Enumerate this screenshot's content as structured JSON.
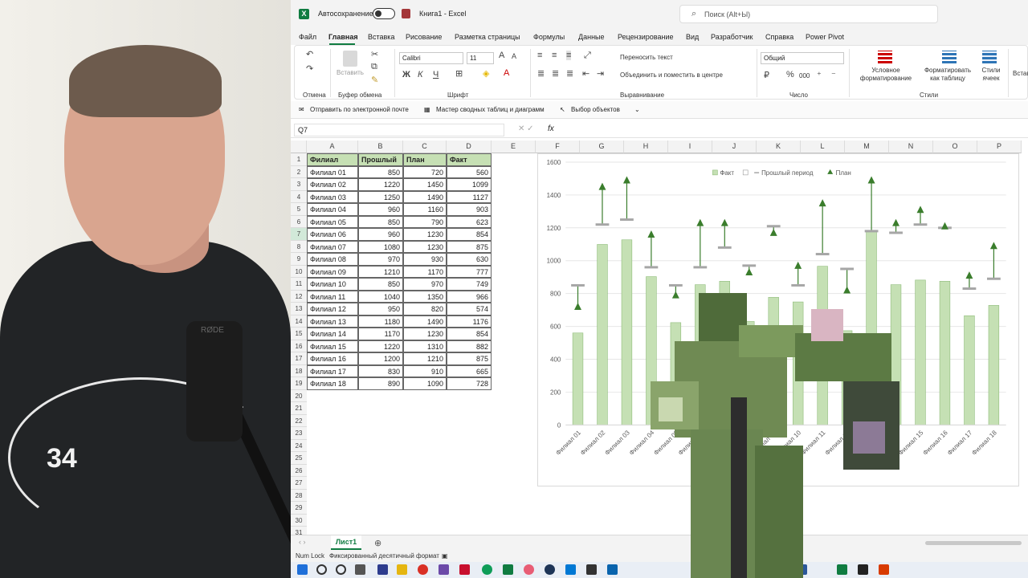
{
  "window": {
    "autosave_label": "Автосохранение",
    "title": "Книга1  -  Excel",
    "search_placeholder": "Поиск (Alt+Ы)"
  },
  "menu": [
    "Файл",
    "Главная",
    "Вставка",
    "Рисование",
    "Разметка страницы",
    "Формулы",
    "Данные",
    "Рецензирование",
    "Вид",
    "Разработчик",
    "Справка",
    "Power Pivot"
  ],
  "ribbon": {
    "undo_group": "Отмена",
    "paste_label": "Вставить",
    "clipboard_group": "Буфер обмена",
    "font_name": "Calibri",
    "font_size": "11",
    "font_group": "Шрифт",
    "bold": "Ж",
    "italic": "К",
    "underline": "Ч",
    "wrap_text": "Переносить текст",
    "merge_center": "Объединить и поместить в центре",
    "alignment_group": "Выравнивание",
    "number_format": "Общий",
    "number_group": "Число",
    "percent": "%",
    "thousands": "000",
    "conditional_formatting": "Условное форматирование",
    "format_as_table": "Форматировать как таблицу",
    "cell_styles": "Стили ячеек",
    "styles_group": "Стили",
    "insert_partial": "Встав"
  },
  "quick_access": {
    "send_email": "Отправить по электронной почте",
    "pivot_wizard": "Мастер сводных таблиц и диаграмм",
    "select_objects": "Выбор объектов"
  },
  "formula_bar": {
    "name_box": "Q7",
    "fx": "fx"
  },
  "columns": [
    "A",
    "B",
    "C",
    "D",
    "E",
    "F",
    "G",
    "H",
    "I",
    "J",
    "K",
    "L",
    "M",
    "N",
    "O",
    "P"
  ],
  "table": {
    "headers": [
      "Филиал",
      "Прошлый",
      "План",
      "Факт"
    ],
    "rows": [
      [
        "Филиал 01",
        "850",
        "720",
        "560"
      ],
      [
        "Филиал 02",
        "1220",
        "1450",
        "1099"
      ],
      [
        "Филиал 03",
        "1250",
        "1490",
        "1127"
      ],
      [
        "Филиал 04",
        "960",
        "1160",
        "903"
      ],
      [
        "Филиал 05",
        "850",
        "790",
        "623"
      ],
      [
        "Филиал 06",
        "960",
        "1230",
        "854"
      ],
      [
        "Филиал 07",
        "1080",
        "1230",
        "875"
      ],
      [
        "Филиал 08",
        "970",
        "930",
        "630"
      ],
      [
        "Филиал 09",
        "1210",
        "1170",
        "777"
      ],
      [
        "Филиал 10",
        "850",
        "970",
        "749"
      ],
      [
        "Филиал 11",
        "1040",
        "1350",
        "966"
      ],
      [
        "Филиал 12",
        "950",
        "820",
        "574"
      ],
      [
        "Филиал 13",
        "1180",
        "1490",
        "1176"
      ],
      [
        "Филиал 14",
        "1170",
        "1230",
        "854"
      ],
      [
        "Филиал 15",
        "1220",
        "1310",
        "882"
      ],
      [
        "Филиал 16",
        "1200",
        "1210",
        "875"
      ],
      [
        "Филиал 17",
        "830",
        "910",
        "665"
      ],
      [
        "Филиал 18",
        "890",
        "1090",
        "728"
      ]
    ]
  },
  "sheet_tab": "Лист1",
  "status": {
    "num_lock": "Num Lock",
    "fixed_decimal": "Фиксированный десятичный формат"
  },
  "cam": {
    "shirt_number": "34",
    "mic_brand": "RØDE"
  },
  "chart_data": {
    "type": "bar",
    "categories": [
      "Филиал 01",
      "Филиал 02",
      "Филиал 03",
      "Филиал 04",
      "Филиал 05",
      "Филиал 06",
      "Филиал 07",
      "Филиал 08",
      "Филиал 09",
      "Филиал 10",
      "Филиал 11",
      "Филиал 12",
      "Филиал 13",
      "Филиал 14",
      "Филиал 15",
      "Филиал 16",
      "Филиал 17",
      "Филиал 18"
    ],
    "series": [
      {
        "name": "Факт",
        "kind": "bar",
        "color": "#c5e0b4",
        "values": [
          560,
          1099,
          1127,
          903,
          623,
          854,
          875,
          630,
          777,
          749,
          966,
          574,
          1176,
          854,
          882,
          875,
          665,
          728
        ]
      },
      {
        "name": "Прошлый период",
        "kind": "dash",
        "color": "#a6a6a6",
        "values": [
          850,
          1220,
          1250,
          960,
          850,
          960,
          1080,
          970,
          1210,
          850,
          1040,
          950,
          1180,
          1170,
          1220,
          1200,
          830,
          890
        ]
      },
      {
        "name": "План",
        "kind": "triangle",
        "color": "#3a7d2c",
        "values": [
          720,
          1450,
          1490,
          1160,
          790,
          1230,
          1230,
          930,
          1170,
          970,
          1350,
          820,
          1490,
          1230,
          1310,
          1210,
          910,
          1090
        ]
      }
    ],
    "ylim": [
      0,
      1600
    ],
    "yticks": [
      "0",
      "200",
      "400",
      "600",
      "800",
      "1000",
      "1200",
      "1400",
      "1600"
    ],
    "legend_position": "top-right",
    "legend_box_label": ""
  }
}
